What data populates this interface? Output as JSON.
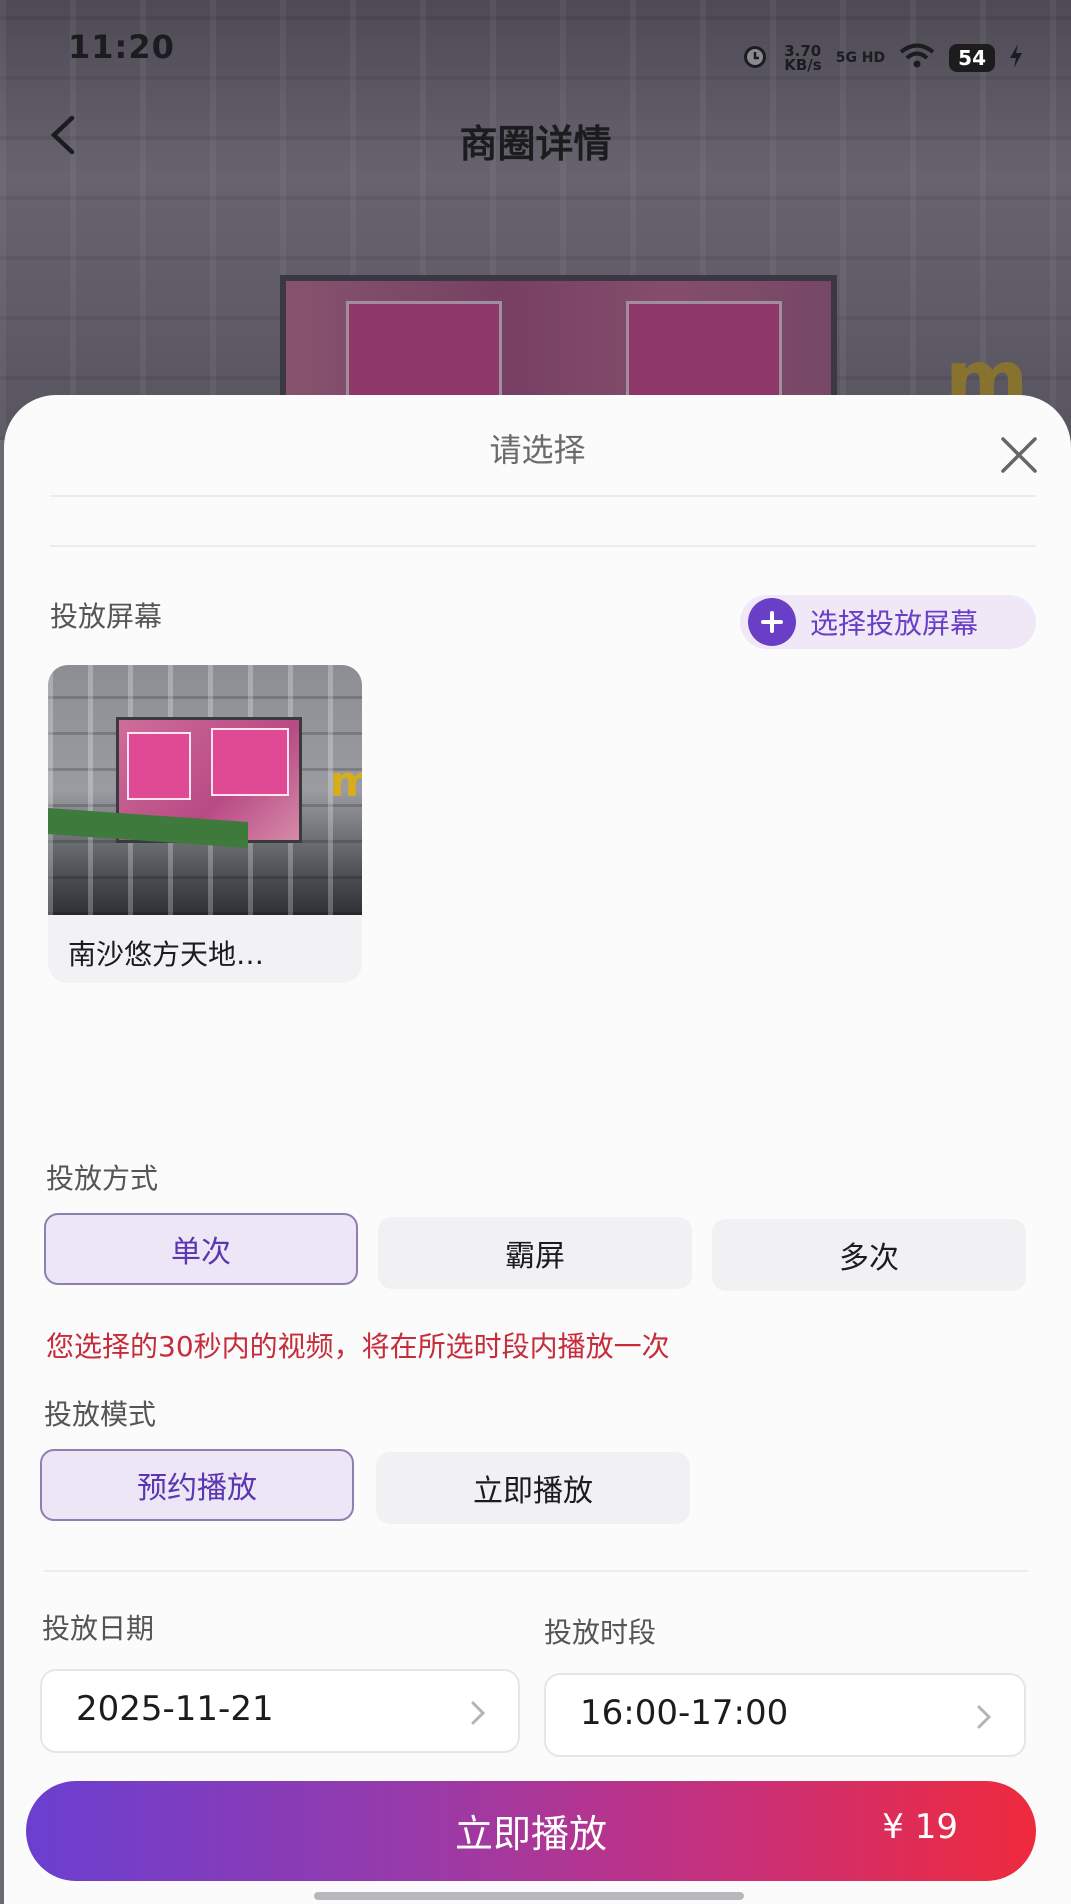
{
  "status_bar": {
    "time": "11:20",
    "net_speed_value": "3.70",
    "net_speed_unit": "KB/s",
    "network": "5G HD",
    "battery": "54"
  },
  "nav": {
    "title": "商圈详情"
  },
  "sheet": {
    "title": "请选择",
    "screen_section": {
      "label": "投放屏幕",
      "select_button": "选择投放屏幕",
      "selected_screen_name": "南沙悠方天地…"
    },
    "mode_section": {
      "label": "投放方式",
      "options": [
        "单次",
        "霸屏",
        "多次"
      ],
      "selected": "单次",
      "notice": "您选择的30秒内的视频，将在所选时段内播放一次"
    },
    "play_mode_section": {
      "label": "投放模式",
      "options": [
        "预约播放",
        "立即播放"
      ],
      "selected": "预约播放"
    },
    "date_section": {
      "label": "投放日期",
      "value": "2025-11-21"
    },
    "time_section": {
      "label": "投放时段",
      "value": "16:00-17:00"
    },
    "cta": {
      "label": "立即播放",
      "price": "¥ 19"
    }
  },
  "colors": {
    "accent": "#6a3fc8",
    "notice": "#c62c3a",
    "cta_gradient_start": "#6a3fd0",
    "cta_gradient_end": "#ef2a3c"
  }
}
